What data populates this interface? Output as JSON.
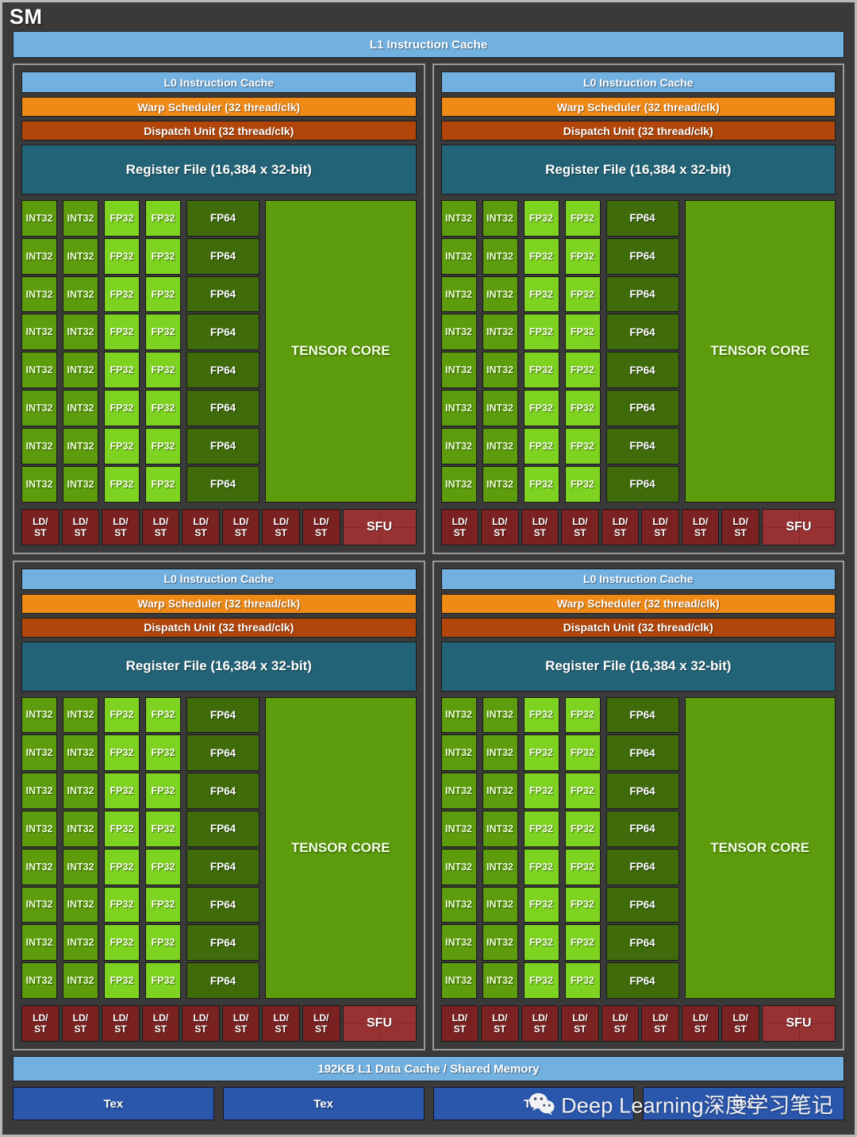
{
  "diagram": {
    "title": "SM",
    "l1_instruction_cache": "L1 Instruction Cache",
    "l1_data_cache": "192KB L1 Data Cache / Shared Memory",
    "partition": {
      "l0_instruction_cache": "L0 Instruction Cache",
      "warp_scheduler": "Warp Scheduler (32 thread/clk)",
      "dispatch_unit": "Dispatch Unit (32 thread/clk)",
      "register_file": "Register File (16,384 x 32-bit)",
      "int32": "INT32",
      "fp32": "FP32",
      "fp64": "FP64",
      "tensor_core": "TENSOR CORE",
      "ldst": "LD/\nST",
      "ldst_line1": "LD/",
      "ldst_line2": "ST",
      "sfu": "SFU",
      "core_rows": 8,
      "int32_cols": 2,
      "fp32_cols": 2,
      "fp64_cols": 1,
      "ldst_count": 8
    },
    "partition_count": 4,
    "tex_blocks": [
      "Tex",
      "Tex",
      "Tex",
      "Tex"
    ],
    "watermark": {
      "logo": "wechat-icon",
      "text": "Deep Learning深度学习笔记"
    },
    "colors": {
      "background": "#3a3a3a",
      "frame_border": "#b9b9b9",
      "partition_border": "#9a9a9a",
      "cache_blue": "#72b0e0",
      "warp_orange": "#f08a17",
      "dispatch_brown": "#b2460a",
      "register_teal": "#226377",
      "int32_green": "#5d9c0d",
      "fp32_green": "#7ed321",
      "fp64_green": "#3f6b0b",
      "tensor_green": "#5d9c0d",
      "ldst_red": "#7a2222",
      "sfu_red": "#983232",
      "tex_blue": "#2a56ab",
      "text_white": "#ffffff"
    }
  }
}
